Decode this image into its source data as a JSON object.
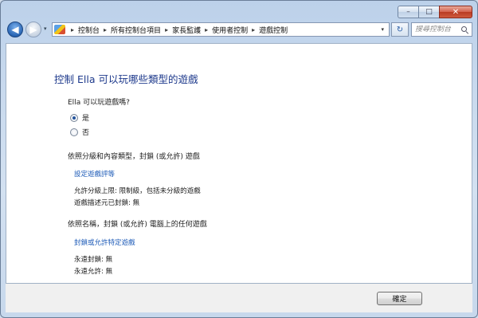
{
  "window": {
    "min_glyph": "–",
    "max_glyph": "□",
    "close_glyph": "✕"
  },
  "navbar": {
    "back_glyph": "◀",
    "forward_glyph": "▶",
    "history_glyph": "▾",
    "breadcrumbs": [
      "控制台",
      "所有控制台項目",
      "家長監護",
      "使用者控制",
      "遊戲控制"
    ],
    "separator": "▸",
    "address_drop_glyph": "▾",
    "refresh_glyph": "↻",
    "search_placeholder": "搜尋控制台"
  },
  "main": {
    "title": "控制 Ella 可以玩哪些類型的遊戲",
    "question": "Ella 可以玩遊戲嗎?",
    "options": [
      {
        "label": "是",
        "checked": true
      },
      {
        "label": "否",
        "checked": false
      }
    ],
    "rating_section": {
      "heading": "依照分級和內容類型，封鎖 (或允許) 遊戲",
      "link": "設定遊戲評等",
      "info1": "允許分級上限: 限制級，包括未分級的遊戲",
      "info2": "遊戲描述元已封鎖: 無"
    },
    "name_section": {
      "heading": "依照名稱，封鎖 (或允許) 電腦上的任何遊戲",
      "link": "封鎖或允許特定遊戲",
      "info1": "永遠封鎖: 無",
      "info2": "永遠允許: 無"
    }
  },
  "footer": {
    "ok_label": "確定"
  }
}
